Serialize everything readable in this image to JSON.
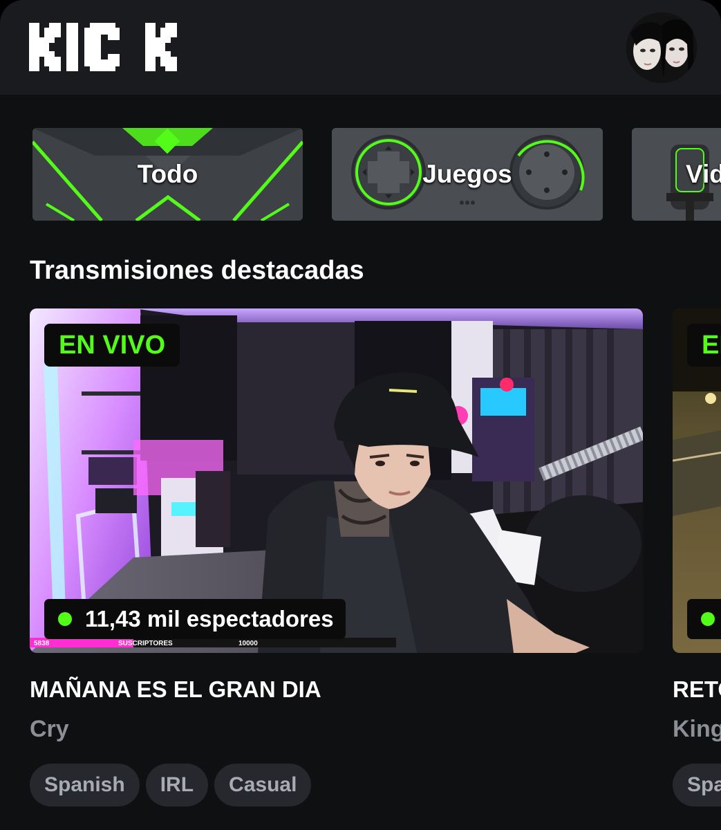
{
  "header": {
    "logo_text": "KICK",
    "avatar_alt": "profile avatar"
  },
  "categories": [
    {
      "label": "Todo"
    },
    {
      "label": "Juegos"
    },
    {
      "label": "Vid"
    }
  ],
  "section": {
    "title": "Transmisiones destacadas"
  },
  "streams": [
    {
      "live_badge": "EN VIVO",
      "viewers": "11,43 mil espectadores",
      "title": "MAÑANA ES EL GRAN DIA",
      "streamer": "Cry",
      "tags": [
        "Spanish",
        "IRL",
        "Casual"
      ],
      "overlay": {
        "left": "5838",
        "center": "SUSCRIPTORES",
        "right": "10000"
      }
    },
    {
      "live_badge": "EN VIVO",
      "viewers": "",
      "title": "RETO",
      "streamer": "King",
      "tags": [
        "Spanish"
      ]
    }
  ],
  "colors": {
    "accent": "#53fc18",
    "header_bg": "#191b1f",
    "page_bg": "#0f1011",
    "tag_bg": "#26282d",
    "muted_text": "#8c8f96"
  }
}
